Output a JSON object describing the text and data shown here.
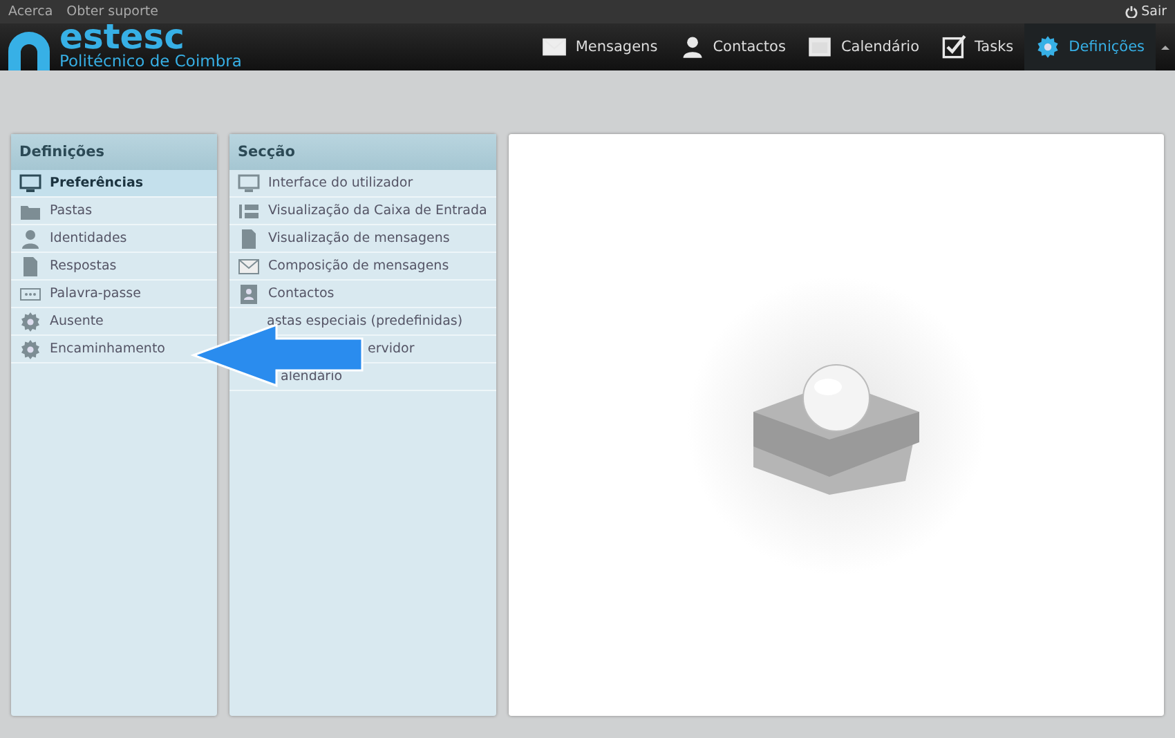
{
  "top_links": [
    "Acerca",
    "Obter suporte"
  ],
  "logout": "Sair",
  "logo": {
    "name": "estesc",
    "subtitle": "Politécnico de Coimbra"
  },
  "nav": [
    {
      "label": "Mensagens",
      "selected": false
    },
    {
      "label": "Contactos",
      "selected": false
    },
    {
      "label": "Calendário",
      "selected": false
    },
    {
      "label": "Tasks",
      "selected": false
    },
    {
      "label": "Definições",
      "selected": true
    }
  ],
  "settings": {
    "title": "Definições",
    "items": [
      {
        "label": "Preferências",
        "selected": true
      },
      {
        "label": "Pastas",
        "selected": false
      },
      {
        "label": "Identidades",
        "selected": false
      },
      {
        "label": "Respostas",
        "selected": false
      },
      {
        "label": "Palavra-passe",
        "selected": false
      },
      {
        "label": "Ausente",
        "selected": false
      },
      {
        "label": "Encaminhamento",
        "selected": false
      }
    ]
  },
  "section": {
    "title": "Secção",
    "items": [
      {
        "label": "Interface do utilizador",
        "kind": "full"
      },
      {
        "label": "Visualização da Caixa de Entrada",
        "kind": "full"
      },
      {
        "label": "Visualização de mensagens",
        "kind": "full"
      },
      {
        "label": "Composição de mensagens",
        "kind": "full"
      },
      {
        "label": "Contactos",
        "kind": "full"
      },
      {
        "label": "astas especiais (predefinidas)",
        "kind": "covered"
      },
      {
        "label": "ervidor",
        "kind": "covered_more"
      },
      {
        "label": "alendário",
        "kind": "covered_tail"
      }
    ]
  },
  "pointer_arrow": {
    "kind": "arrow"
  }
}
